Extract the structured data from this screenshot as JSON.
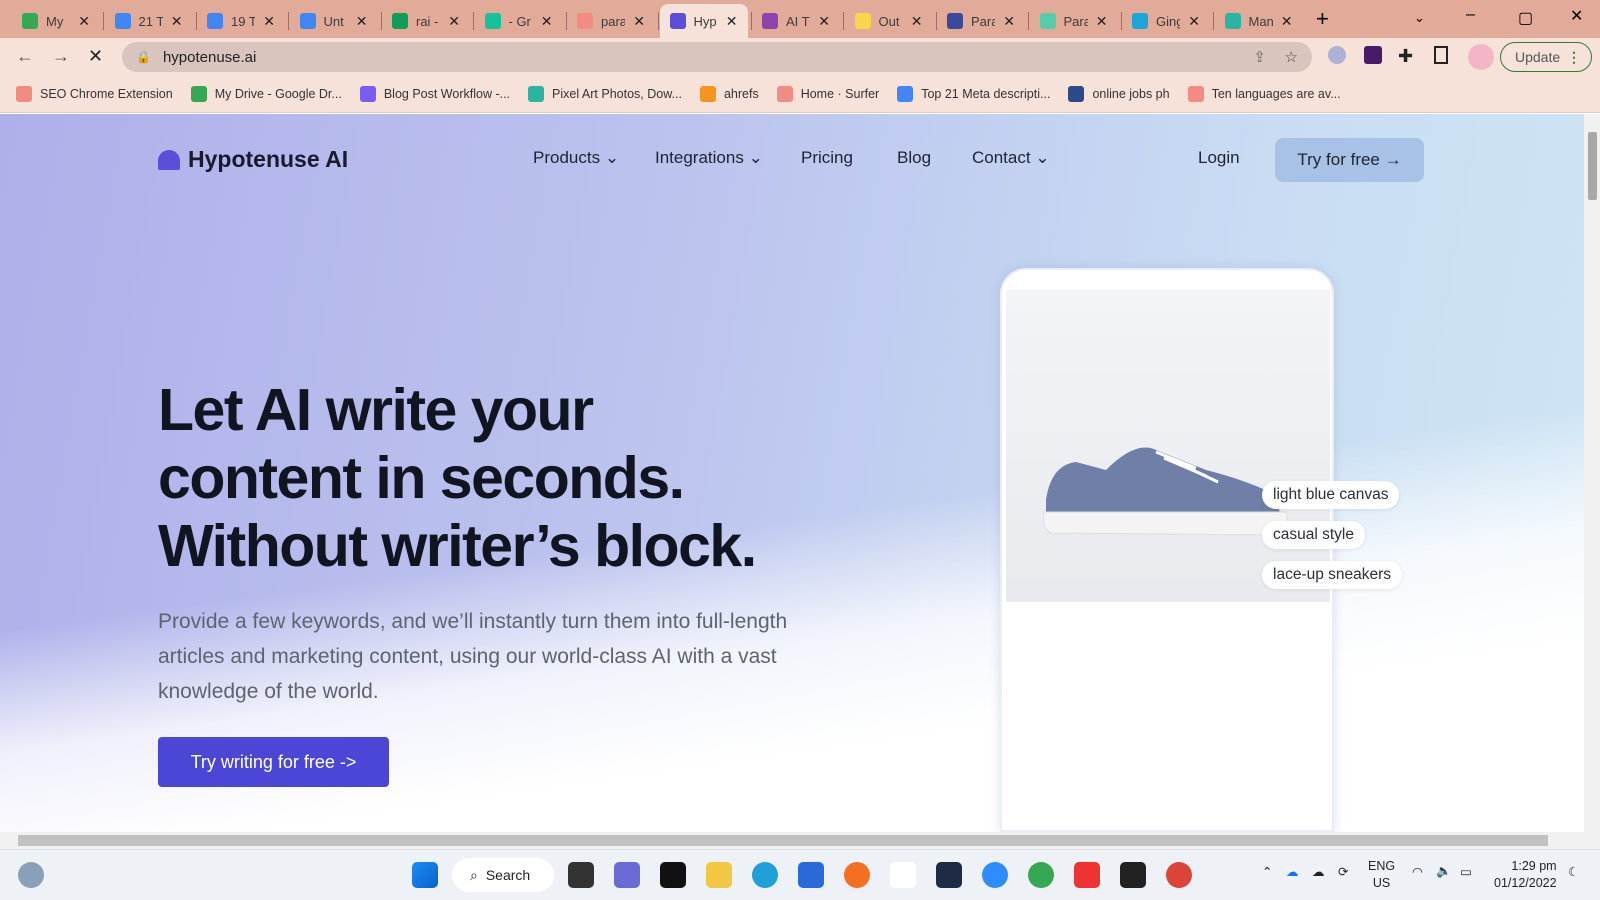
{
  "browser": {
    "tabs": [
      {
        "title": "My",
        "icon": "google-drive-icon",
        "color": "#34a853"
      },
      {
        "title": "21 T",
        "icon": "google-docs-icon",
        "color": "#4285f4"
      },
      {
        "title": "19 T",
        "icon": "google-docs-icon",
        "color": "#4285f4"
      },
      {
        "title": "Unt",
        "icon": "google-docs-icon",
        "color": "#4285f4"
      },
      {
        "title": "rai -",
        "icon": "google-sheets-icon",
        "color": "#0f9d58"
      },
      {
        "title": "- Gr",
        "icon": "grammarly-icon",
        "color": "#15c39a"
      },
      {
        "title": "para",
        "icon": "surfer-icon",
        "color": "#f28b82"
      },
      {
        "title": "Hyp",
        "icon": "hypotenuse-icon",
        "color": "#5a4fd6"
      },
      {
        "title": "AI T",
        "icon": "ai-head-icon",
        "color": "#8e44ad"
      },
      {
        "title": "Out",
        "icon": "outranking-icon",
        "color": "#f7d64a"
      },
      {
        "title": "Paraphra",
        "icon": "paraphrase-robot-icon",
        "color": "#3a4a9a"
      },
      {
        "title": "Paraphra",
        "icon": "paraphrase-robot-icon",
        "color": "#5ca"
      },
      {
        "title": "Ginger S",
        "icon": "ginger-icon",
        "color": "#1aa6d9"
      },
      {
        "title": "Man in V",
        "icon": "pixel-art-icon",
        "color": "#2bb3a3"
      }
    ],
    "active_tab": 7,
    "url": "hypotenuse.ai",
    "update_label": "Update",
    "bookmarks": [
      {
        "label": "SEO Chrome Extension",
        "color": "#f28b82"
      },
      {
        "label": "My Drive - Google Dr...",
        "color": "#34a853"
      },
      {
        "label": "Blog Post Workflow -...",
        "color": "#7b5cf0"
      },
      {
        "label": "Pixel Art Photos, Dow...",
        "color": "#2bb3a3"
      },
      {
        "label": "ahrefs",
        "color": "#f7931e"
      },
      {
        "label": "Home · Surfer",
        "color": "#f28b82"
      },
      {
        "label": "Top 21 Meta descripti...",
        "color": "#4285f4"
      },
      {
        "label": "online jobs ph",
        "color": "#2a4a8a"
      },
      {
        "label": "Ten languages are av...",
        "color": "#f28b82"
      }
    ]
  },
  "site": {
    "brand": "Hypotenuse AI",
    "nav": [
      "Products",
      "Integrations",
      "Pricing",
      "Blog",
      "Contact"
    ],
    "login": "Login",
    "try_free": "Try for free →",
    "headline": [
      "Let AI write your",
      "content in seconds.",
      "Without writer’s block."
    ],
    "subtext": "Provide a few keywords, and we’ll instantly turn them into full-length articles and marketing content, using our world-class AI with a vast knowledge of the world.",
    "cta": "Try writing for free ->",
    "tags": [
      "light blue canvas",
      "casual style",
      "lace-up sneakers"
    ],
    "accent": "#4c46d6"
  },
  "taskbar": {
    "search": "Search",
    "lang": "ENG",
    "region": "US",
    "time": "1:29 pm",
    "date": "01/12/2022"
  }
}
